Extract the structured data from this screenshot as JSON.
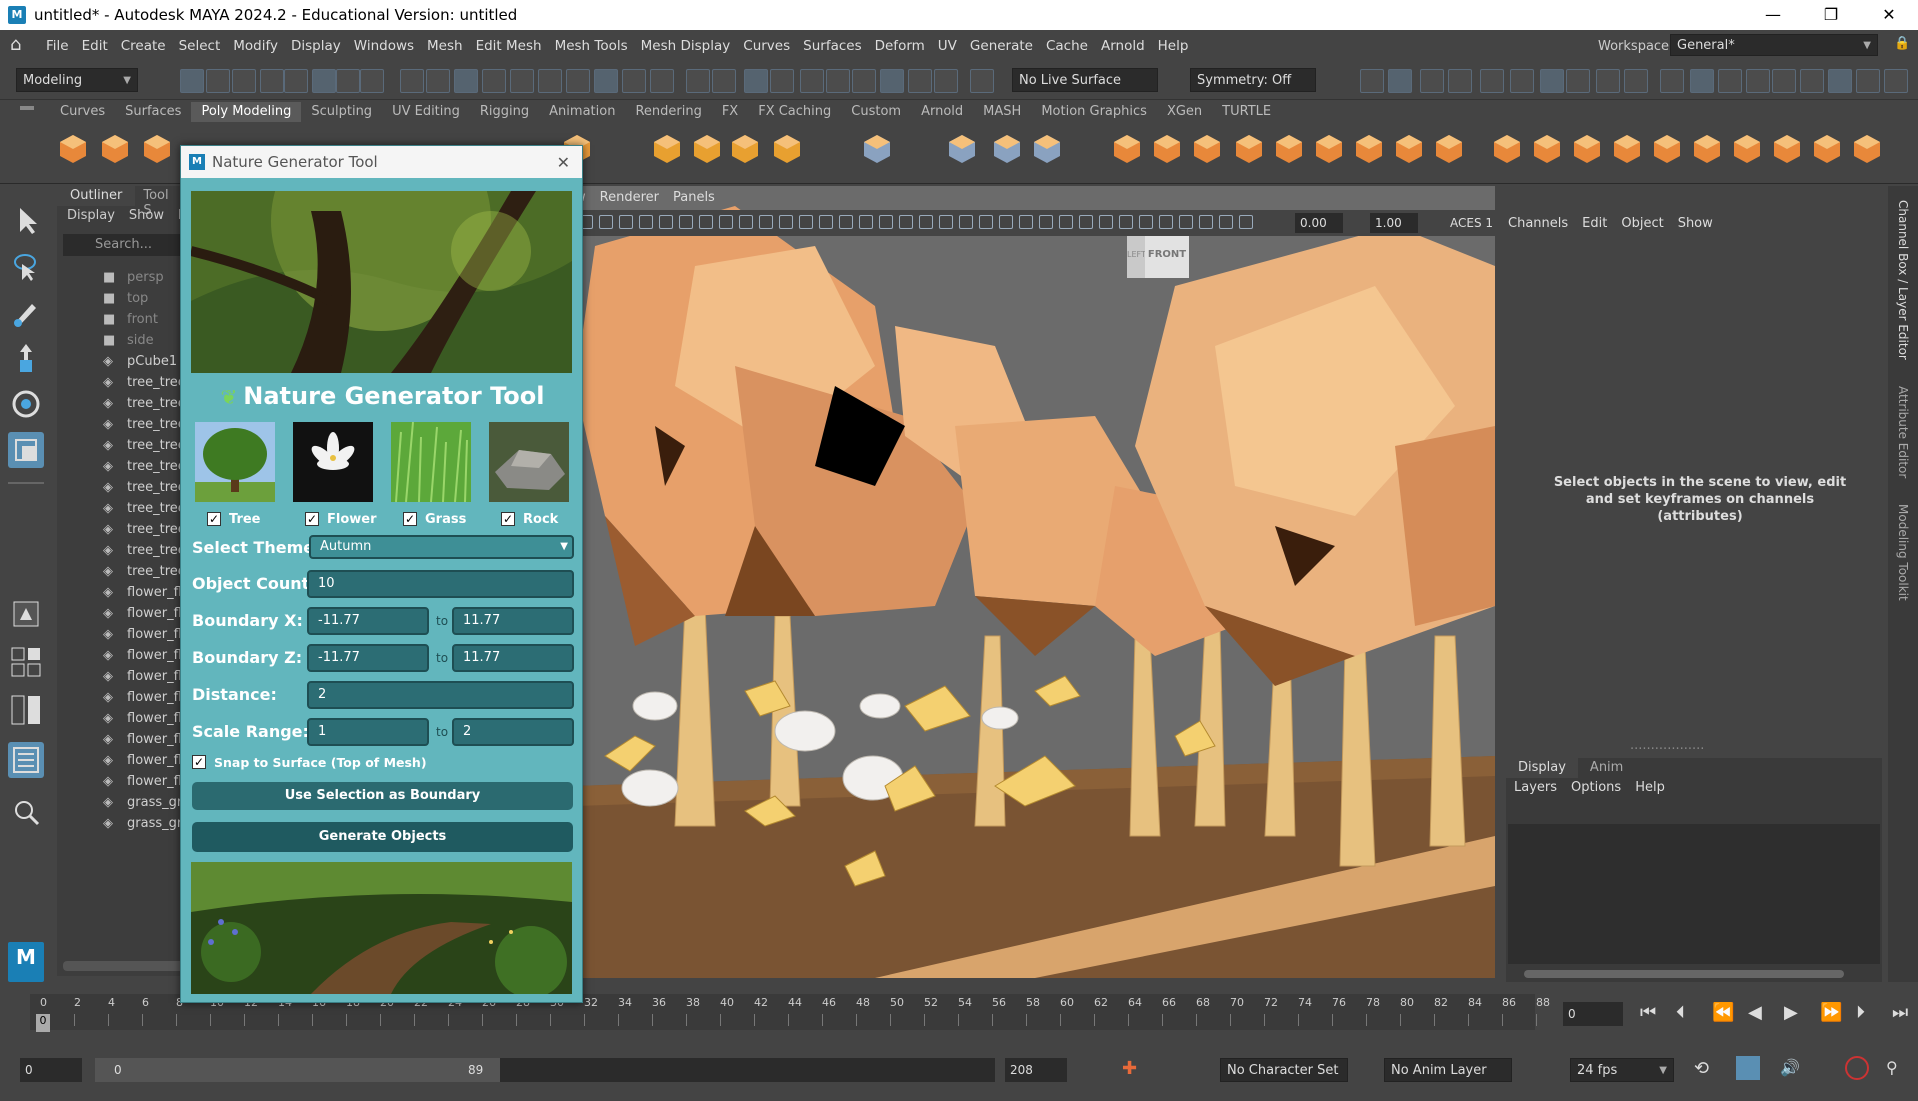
{
  "window": {
    "title": "untitled* - Autodesk MAYA 2024.2 - Educational Version: untitled",
    "logo": "M"
  },
  "menus": [
    "File",
    "Edit",
    "Create",
    "Select",
    "Modify",
    "Display",
    "Windows",
    "Mesh",
    "Edit Mesh",
    "Mesh Tools",
    "Mesh Display",
    "Curves",
    "Surfaces",
    "Deform",
    "UV",
    "Generate",
    "Cache",
    "Arnold",
    "Help"
  ],
  "workspace": {
    "label": "Workspace:",
    "value": "General*"
  },
  "mode_dropdown": "Modeling",
  "live_surface": "No Live Surface",
  "symmetry": "Symmetry: Off",
  "shelf_tabs": [
    "Curves",
    "Surfaces",
    "Poly Modeling",
    "Sculpting",
    "UV Editing",
    "Rigging",
    "Animation",
    "Rendering",
    "FX",
    "FX Caching",
    "Custom",
    "Arnold",
    "MASH",
    "Motion Graphics",
    "XGen",
    "TURTLE"
  ],
  "shelf_active": "Poly Modeling",
  "outliner": {
    "tabs": [
      "Outliner",
      "Tool S"
    ],
    "menu": [
      "Display",
      "Show",
      "H"
    ],
    "search_placeholder": "Search...",
    "items": [
      "persp",
      "top",
      "front",
      "side",
      "pCube1",
      "tree_tree",
      "tree_tree",
      "tree_tree",
      "tree_tree",
      "tree_tree",
      "tree_tree",
      "tree_tree",
      "tree_tree",
      "tree_tree",
      "tree_tree",
      "flower_flo",
      "flower_flo",
      "flower_flo",
      "flower_flo",
      "flower_flo",
      "flower_flo",
      "flower_flo",
      "flower_flo",
      "flower_flo",
      "flower_flo",
      "grass_gra",
      "grass_gra"
    ]
  },
  "viewport": {
    "menu": [
      "w",
      "Renderer",
      "Panels"
    ],
    "exposure": "0.00",
    "gamma": "1.00",
    "colorspace": "ACES 1",
    "cube_left": "LEFT",
    "cube_front": "FRONT"
  },
  "channelbox": {
    "menu": [
      "Channels",
      "Edit",
      "Object",
      "Show"
    ],
    "hint": "Select objects in the scene to view, edit and set keyframes on channels (attributes)",
    "side_tabs": [
      "Channel Box / Layer Editor",
      "Attribute Editor",
      "Modeling Toolkit"
    ]
  },
  "layers": {
    "tabs": [
      "Display",
      "Anim"
    ],
    "menu": [
      "Layers",
      "Options",
      "Help"
    ]
  },
  "tool": {
    "title": "Nature Generator Tool",
    "heading": "Nature Generator Tool",
    "categories": [
      {
        "label": "Tree",
        "checked": true
      },
      {
        "label": "Flower",
        "checked": true
      },
      {
        "label": "Grass",
        "checked": true
      },
      {
        "label": "Rock",
        "checked": true
      }
    ],
    "theme_label": "Select Theme:",
    "theme_value": "Autumn",
    "count_label": "Object Count:",
    "count_value": "10",
    "bx_label": "Boundary X:",
    "bx_min": "-11.77",
    "bx_max": "11.77",
    "bz_label": "Boundary Z:",
    "bz_min": "-11.77",
    "bz_max": "11.77",
    "to": "to",
    "distance_label": "Distance:",
    "distance_value": "2",
    "scale_label": "Scale Range:",
    "scale_min": "1",
    "scale_max": "2",
    "snap_label": "Snap to Surface (Top of Mesh)",
    "snap_checked": true,
    "use_selection_btn": "Use Selection as Boundary",
    "generate_btn": "Generate Objects"
  },
  "timeline": {
    "ticks": [
      "0",
      "2",
      "4",
      "6",
      "8",
      "10",
      "12",
      "14",
      "16",
      "18",
      "20",
      "22",
      "24",
      "26",
      "28",
      "30",
      "32",
      "34",
      "36",
      "38",
      "40",
      "42",
      "44",
      "46",
      "48",
      "50",
      "52",
      "54",
      "56",
      "58",
      "60",
      "62",
      "64",
      "66",
      "68",
      "70",
      "72",
      "74",
      "76",
      "78",
      "80",
      "82",
      "84",
      "86",
      "88"
    ],
    "current": "0",
    "frame_field": "0"
  },
  "range": {
    "start": "0",
    "inner_start": "0",
    "inner_end": "89",
    "end": "208",
    "char_set": "No Character Set",
    "anim_layer": "No Anim Layer",
    "fps": "24 fps"
  },
  "colors": {
    "accent": "#62b6bd",
    "dark": "#444444",
    "viewport": "#6b6b6b",
    "ground": "#7a5433"
  }
}
